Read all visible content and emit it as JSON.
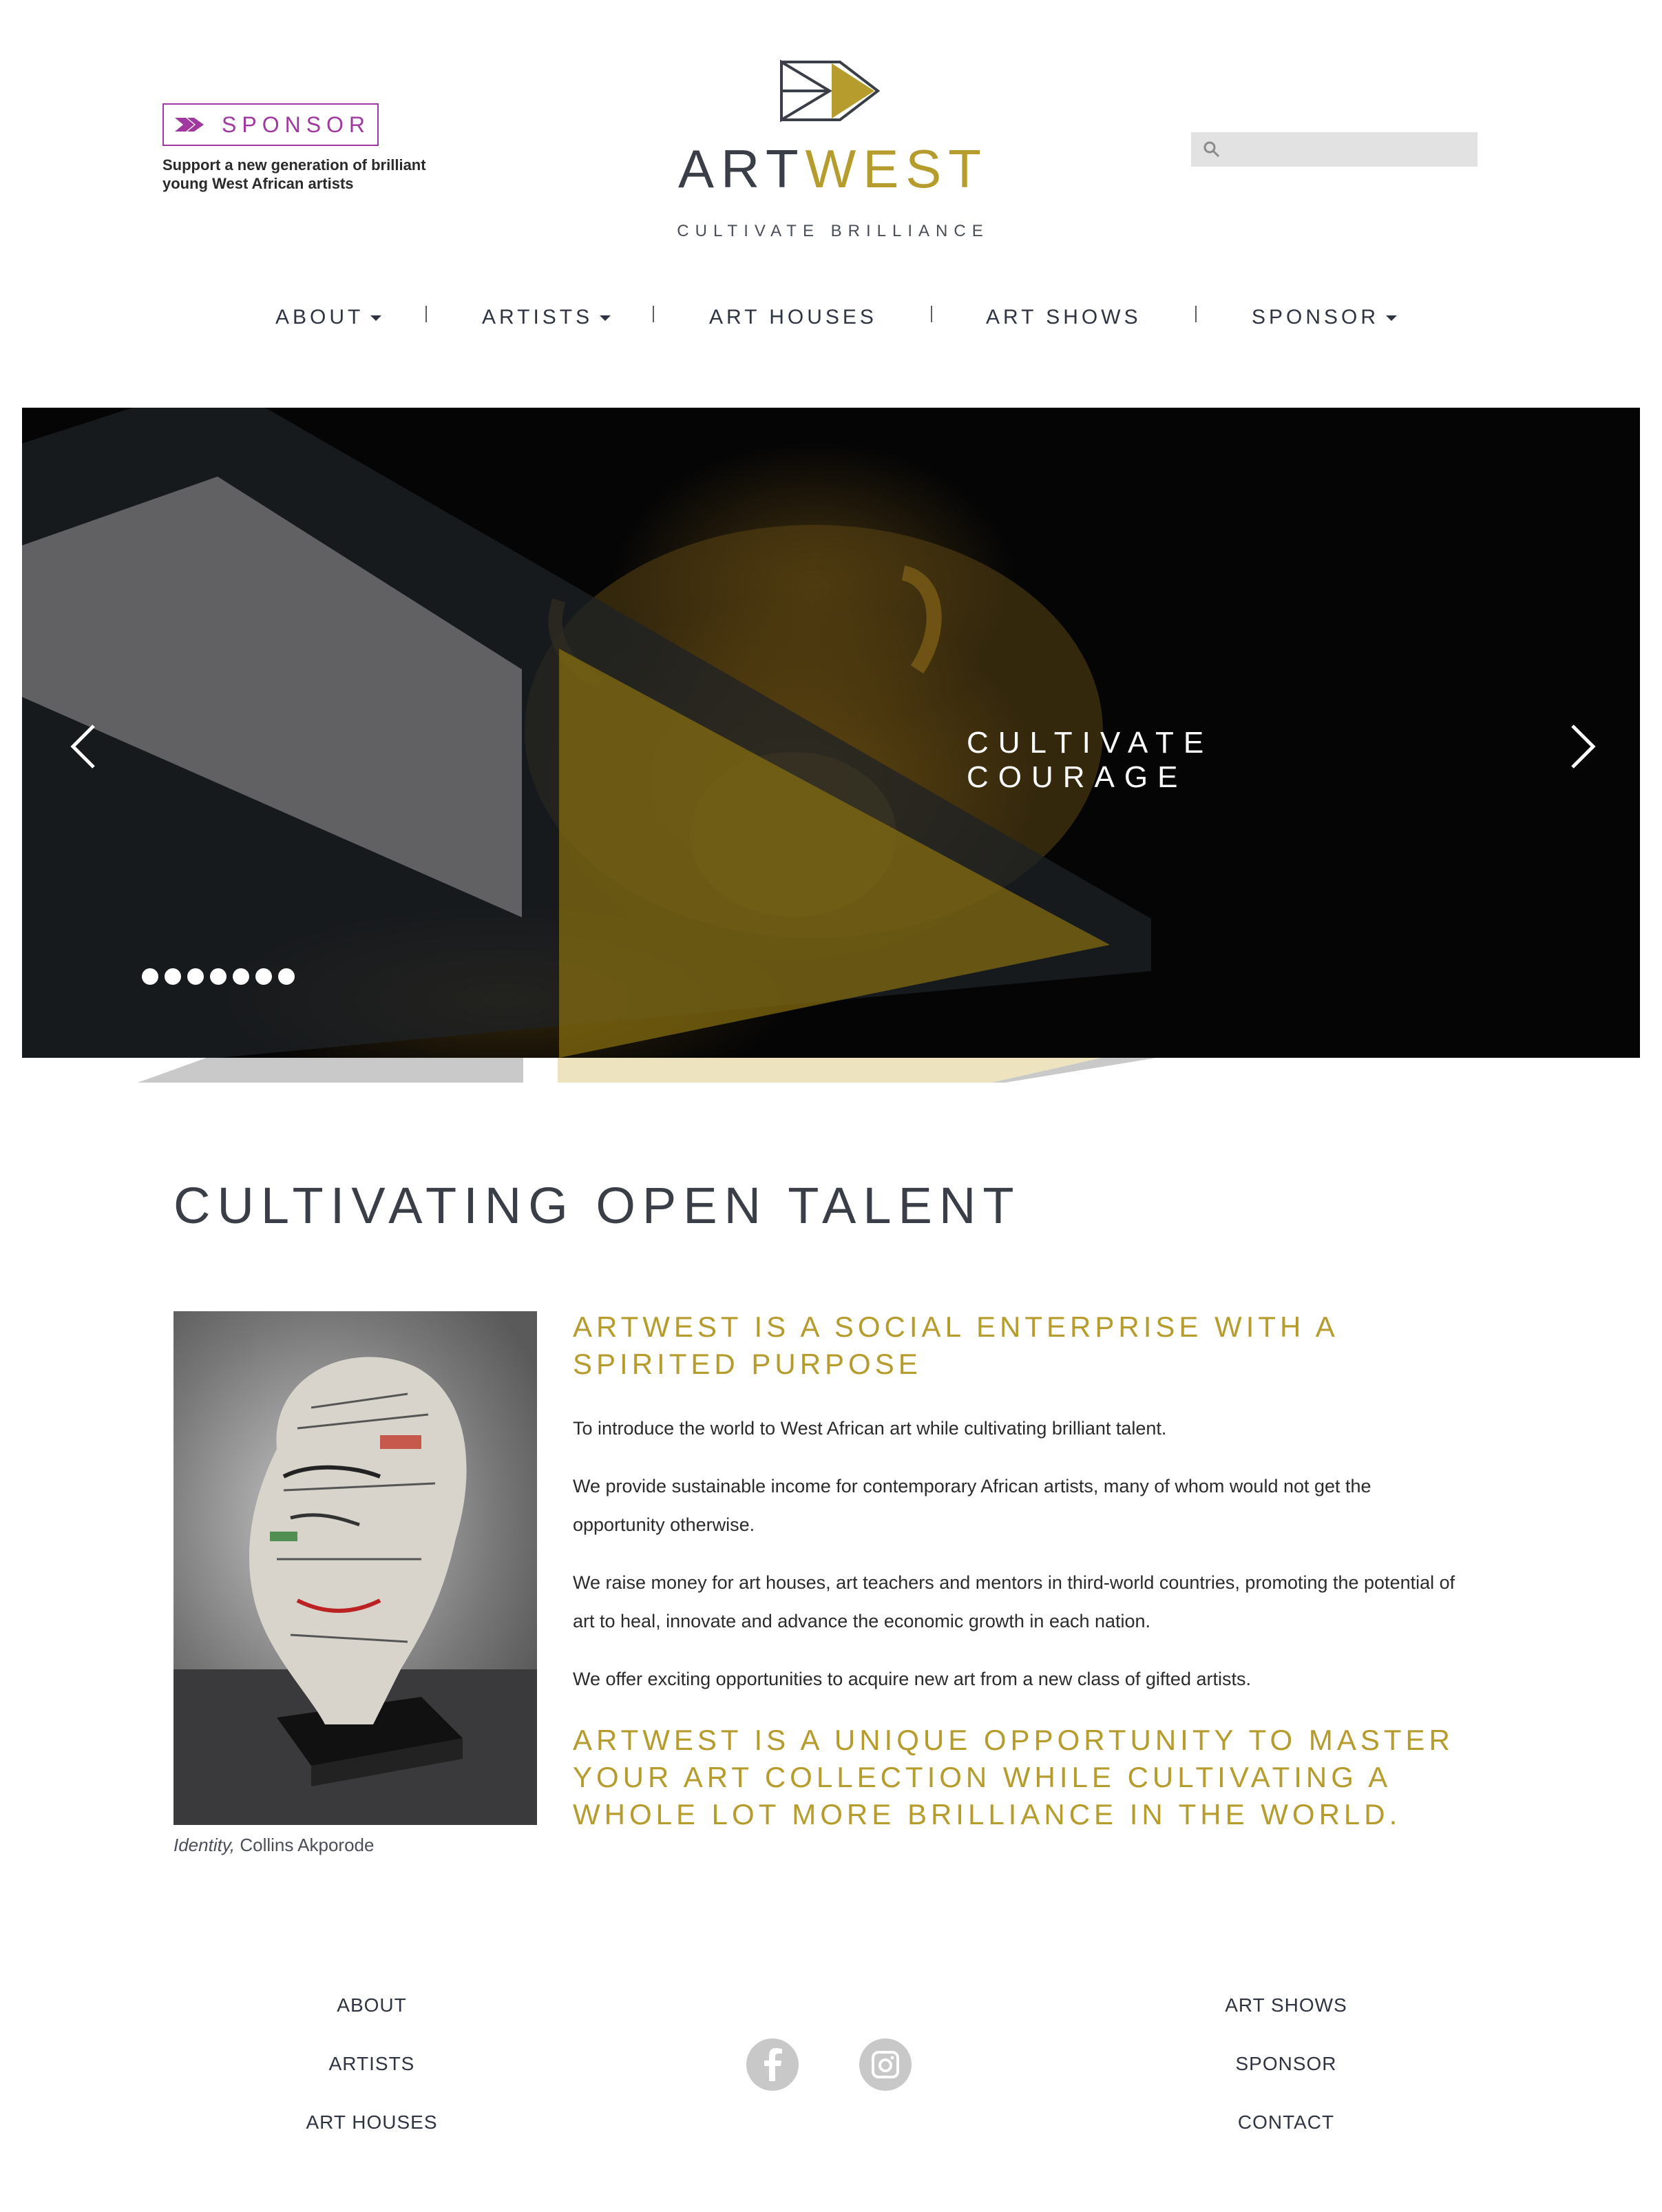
{
  "header": {
    "sponsor_label": "SPONSOR",
    "sponsor_tagline": "Support a new generation of brilliant young West African artists",
    "logo_art": "ART",
    "logo_west": "WEST",
    "logo_tagline": "CULTIVATE BRILLIANCE",
    "search_placeholder": ""
  },
  "nav": {
    "items": [
      {
        "label": "ABOUT",
        "has_dropdown": true
      },
      {
        "label": "ARTISTS",
        "has_dropdown": true
      },
      {
        "label": "ART HOUSES",
        "has_dropdown": false
      },
      {
        "label": "ART SHOWS",
        "has_dropdown": false
      },
      {
        "label": "SPONSOR",
        "has_dropdown": true
      }
    ]
  },
  "hero": {
    "caption": "CULTIVATE COURAGE",
    "slide_count": 7,
    "active_slide": 1
  },
  "main": {
    "title": "CULTIVATING OPEN TALENT",
    "image_caption_title": "Identity,",
    "image_caption_artist": " Collins Akporode",
    "heading_1": "ARTWEST IS A SOCIAL ENTERPRISE WITH A SPIRITED PURPOSE",
    "paragraphs": [
      "To introduce the world to West African art while cultivating brilliant talent.",
      "We provide sustainable income for contemporary African artists, many of whom would not get the opportunity otherwise.",
      "We raise money for art houses, art teachers and mentors in third-world countries, promoting the potential of art to heal, innovate and advance the economic growth in each nation.",
      "We offer exciting opportunities to acquire new art from a new class of gifted artists."
    ],
    "heading_2": "ARTWEST IS A UNIQUE OPPORTUNITY TO MASTER YOUR ART COLLECTION WHILE CULTIVATING A WHOLE LOT MORE BRILLIANCE IN THE WORLD."
  },
  "footer": {
    "left_links": [
      "ABOUT",
      "ARTISTS",
      "ART HOUSES"
    ],
    "right_links": [
      "ART SHOWS",
      "SPONSOR",
      "CONTACT"
    ],
    "social": [
      "facebook-icon",
      "instagram-icon"
    ]
  },
  "colors": {
    "gold": "#b59c2c",
    "sponsor_purple": "#a0399f",
    "text_dark": "#3a3f47"
  }
}
